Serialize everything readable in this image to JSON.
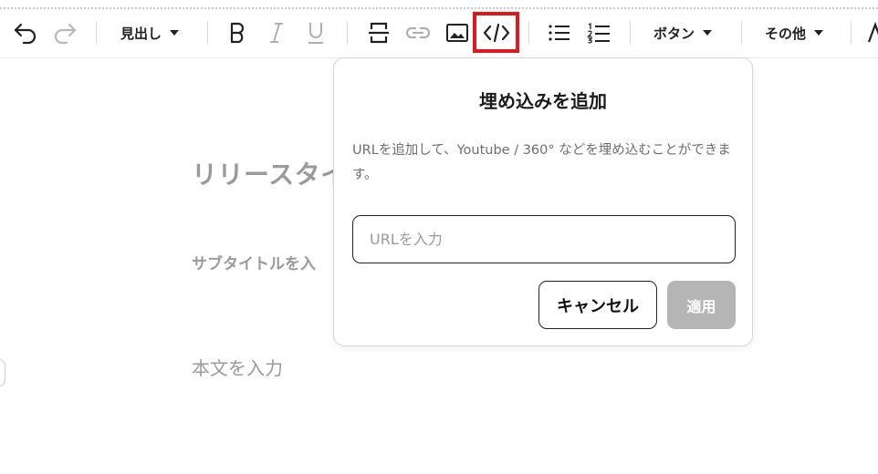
{
  "toolbar": {
    "heading_label": "見出し",
    "button_label": "ボタン",
    "other_label": "その他",
    "icons": [
      "undo-icon",
      "redo-icon",
      "bold-icon",
      "italic-icon",
      "underline-icon",
      "strikethrough-icon",
      "link-icon",
      "image-icon",
      "embed-icon",
      "bullet-list-icon",
      "numbered-list-icon"
    ]
  },
  "editor": {
    "title_placeholder": "リリースタイ",
    "subtitle_placeholder": "サブタイトルを入",
    "body_placeholder": "本文を入力"
  },
  "popup": {
    "title": "埋め込みを追加",
    "description": "URLを追加して、Youtube / 360° などを埋め込むことができます。",
    "input_placeholder": "URLを入力",
    "input_value": "",
    "cancel_label": "キャンセル",
    "apply_label": "適用"
  },
  "colors": {
    "highlight": "#e0191e",
    "apply_disabled": "#b5b5b5",
    "placeholder_text": "#9a9a9a"
  }
}
